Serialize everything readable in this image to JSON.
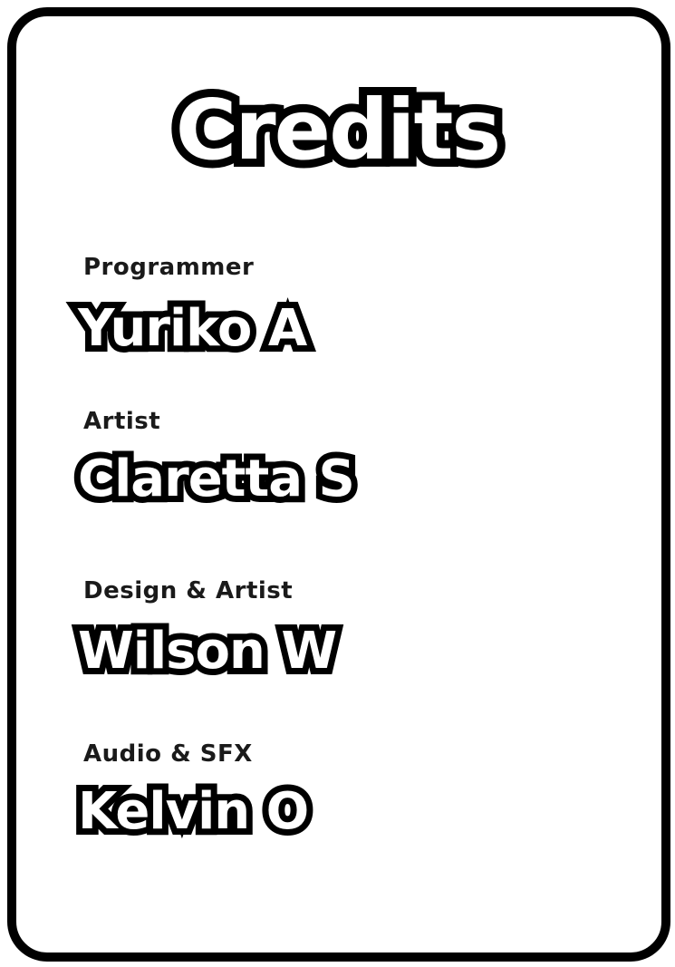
{
  "credits": {
    "title": "Credits",
    "entries": [
      {
        "role": "Programmer",
        "name": "Yuriko A"
      },
      {
        "role": "Artist",
        "name": "Claretta S"
      },
      {
        "role": "Design & Artist",
        "name": "Wilson W"
      },
      {
        "role": "Audio & SFX",
        "name": "Kelvin O"
      }
    ]
  },
  "colors": {
    "background": "#ffffff",
    "outline": "#000000",
    "role_text": "#1a1a1a"
  }
}
